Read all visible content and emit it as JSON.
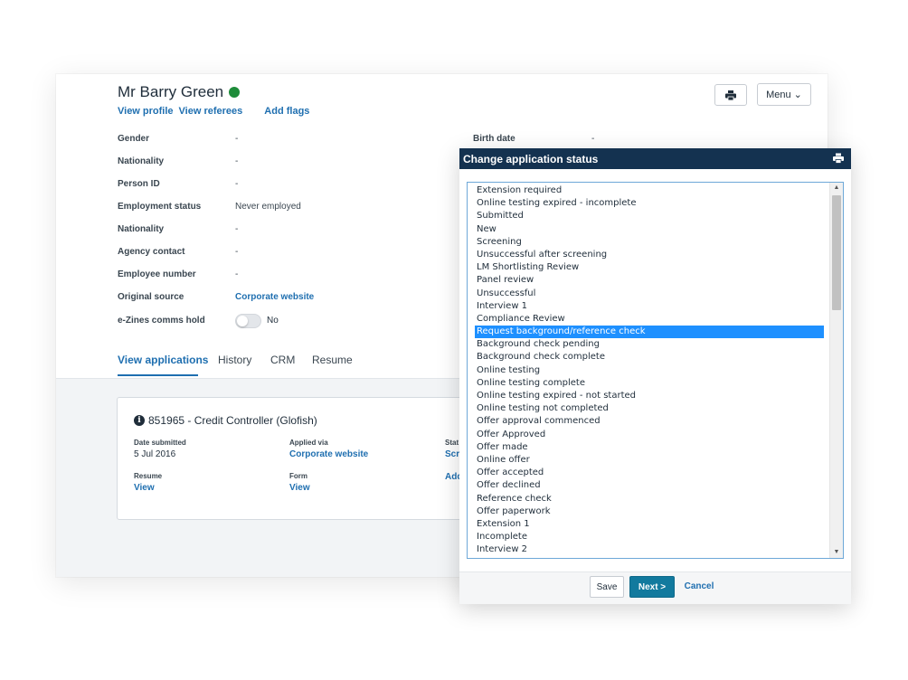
{
  "profile": {
    "name": "Mr Barry Green",
    "links": {
      "view_profile": "View profile",
      "view_referees": "View referees",
      "add_flags": "Add flags"
    },
    "fields": [
      {
        "label": "Gender",
        "value": "-"
      },
      {
        "label": "Nationality",
        "value": "-"
      },
      {
        "label": "Person ID",
        "value": "-"
      },
      {
        "label": "Employment status",
        "value": "Never employed"
      },
      {
        "label": "Nationality",
        "value": "-"
      },
      {
        "label": "Agency contact",
        "value": "-"
      },
      {
        "label": "Employee number",
        "value": "-"
      },
      {
        "label": "Original source",
        "value": "Corporate website"
      },
      {
        "label": "e-Zines comms hold",
        "value": "No"
      }
    ],
    "birth_date": {
      "label": "Birth date",
      "value": "-"
    }
  },
  "toolbar": {
    "menu_label": "Menu ⌄"
  },
  "tabs": [
    "View applications",
    "History",
    "CRM",
    "Resume"
  ],
  "application": {
    "title": "851965 - Credit Controller (Glofish)",
    "date_submitted_label": "Date submitted",
    "date_submitted": "5 Jul 2016",
    "applied_via_label": "Applied via",
    "applied_via": "Corporate website",
    "status_label_partial": "Stat",
    "status_value_partial": "Scre",
    "resume_label": "Resume",
    "resume_link": "View",
    "form_label": "Form",
    "form_link": "View",
    "add_partial": "Add"
  },
  "modal": {
    "title": "Change application status",
    "options": [
      "Extension required",
      "Online testing expired - incomplete",
      "Submitted",
      "New",
      "Screening",
      "Unsuccessful after screening",
      "LM Shortlisting Review",
      "Panel review",
      "Unsuccessful",
      "Interview 1",
      "Compliance Review",
      "Request background/reference check",
      "Background check pending",
      "Background check complete",
      "Online testing",
      "Online testing complete",
      "Online testing expired - not started",
      "Online testing not completed",
      "Offer approval commenced",
      "Offer Approved",
      "Offer made",
      "Online offer",
      "Offer accepted",
      "Offer declined",
      "Reference check",
      "Offer paperwork",
      "Extension 1",
      "Incomplete",
      "Interview 2"
    ],
    "selected_option": "Request background/reference check",
    "save_label": "Save",
    "next_label": "Next >",
    "cancel_label": "Cancel"
  },
  "colors": {
    "status_online": "#1e8c3a",
    "header_bg": "#143250",
    "primary": "#127a9e",
    "link": "#1f6fb0",
    "selection": "#1e90ff"
  }
}
